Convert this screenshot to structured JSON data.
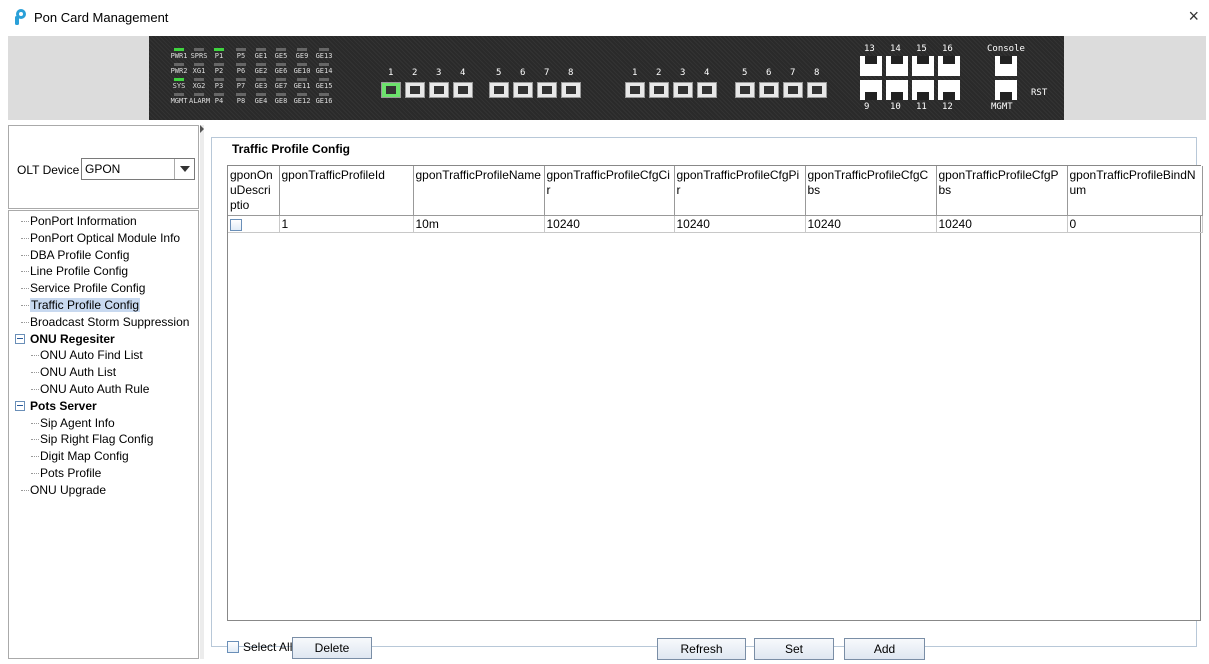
{
  "window": {
    "title": "Pon Card Management",
    "close_glyph": "×"
  },
  "device": {
    "led_columns": [
      {
        "labels": [
          "PWR1",
          "PWR2",
          "SYS",
          "MGMT"
        ],
        "lit": [
          true,
          false,
          true,
          false
        ]
      },
      {
        "labels": [
          "SPRS",
          "XG1",
          "XG2",
          "ALARM"
        ],
        "lit": [
          false,
          false,
          false,
          false
        ]
      },
      {
        "labels": [
          "P1",
          "P2",
          "P3",
          "P4"
        ],
        "lit": [
          true,
          false,
          false,
          false
        ]
      },
      {
        "labels": [
          "P5",
          "P6",
          "P7",
          "P8"
        ],
        "lit": [
          false,
          false,
          false,
          false
        ]
      },
      {
        "labels": [
          "GE1",
          "GE2",
          "GE3",
          "GE4"
        ],
        "lit": [
          false,
          false,
          false,
          false
        ]
      },
      {
        "labels": [
          "GE5",
          "GE6",
          "GE7",
          "GE8"
        ],
        "lit": [
          false,
          false,
          false,
          false
        ]
      },
      {
        "labels": [
          "GE9",
          "GE10",
          "GE11",
          "GE12"
        ],
        "lit": [
          false,
          false,
          false,
          false
        ]
      },
      {
        "labels": [
          "GE13",
          "GE14",
          "GE15",
          "GE16"
        ],
        "lit": [
          false,
          false,
          false,
          false
        ]
      }
    ],
    "pon_ports": [
      "1",
      "2",
      "3",
      "4",
      "5",
      "6",
      "7",
      "8"
    ],
    "ge_ports": [
      "1",
      "2",
      "3",
      "4",
      "5",
      "6",
      "7",
      "8"
    ],
    "top_rj45": [
      "13",
      "14",
      "15",
      "16"
    ],
    "bottom_rj45": [
      "9",
      "10",
      "11",
      "12"
    ],
    "console_label": "Console",
    "mgmt_label": "MGMT",
    "rst_label": "RST"
  },
  "olt": {
    "label": "OLT Device",
    "value": "GPON"
  },
  "tree": [
    {
      "label": "PonPort Information",
      "type": "leaf"
    },
    {
      "label": "PonPort Optical Module Info",
      "type": "leaf"
    },
    {
      "label": "DBA Profile Config",
      "type": "leaf"
    },
    {
      "label": "Line Profile Config",
      "type": "leaf"
    },
    {
      "label": "Service Profile Config",
      "type": "leaf"
    },
    {
      "label": "Traffic Profile Config",
      "type": "leaf",
      "selected": true
    },
    {
      "label": "Broadcast Storm Suppression",
      "type": "leaf"
    },
    {
      "label": "ONU Regesiter",
      "type": "group"
    },
    {
      "label": "ONU Auto Find List",
      "type": "child"
    },
    {
      "label": "ONU Auth List",
      "type": "child"
    },
    {
      "label": "ONU Auto Auth Rule",
      "type": "child"
    },
    {
      "label": "Pots Server",
      "type": "group"
    },
    {
      "label": "Sip Agent Info",
      "type": "child"
    },
    {
      "label": "Sip Right Flag Config",
      "type": "child"
    },
    {
      "label": "Digit Map Config",
      "type": "child"
    },
    {
      "label": "Pots Profile",
      "type": "child"
    },
    {
      "label": "ONU Upgrade",
      "type": "leaf"
    }
  ],
  "panel": {
    "legend": "Traffic Profile Config",
    "columns": [
      "gponOnuDescriptio",
      "gponTrafficProfileId",
      "gponTrafficProfileName",
      "gponTrafficProfileCfgCir",
      "gponTrafficProfileCfgPir",
      "gponTrafficProfileCfgCbs",
      "gponTrafficProfileCfgPbs",
      "gponTrafficProfileBindNum"
    ],
    "rows": [
      {
        "checked": false,
        "cells": [
          "1",
          "10m",
          "10240",
          "10240",
          "10240",
          "10240",
          "0"
        ]
      }
    ]
  },
  "buttons": {
    "select_all": "Select All",
    "delete": "Delete",
    "refresh": "Refresh",
    "set": "Set",
    "add": "Add"
  }
}
